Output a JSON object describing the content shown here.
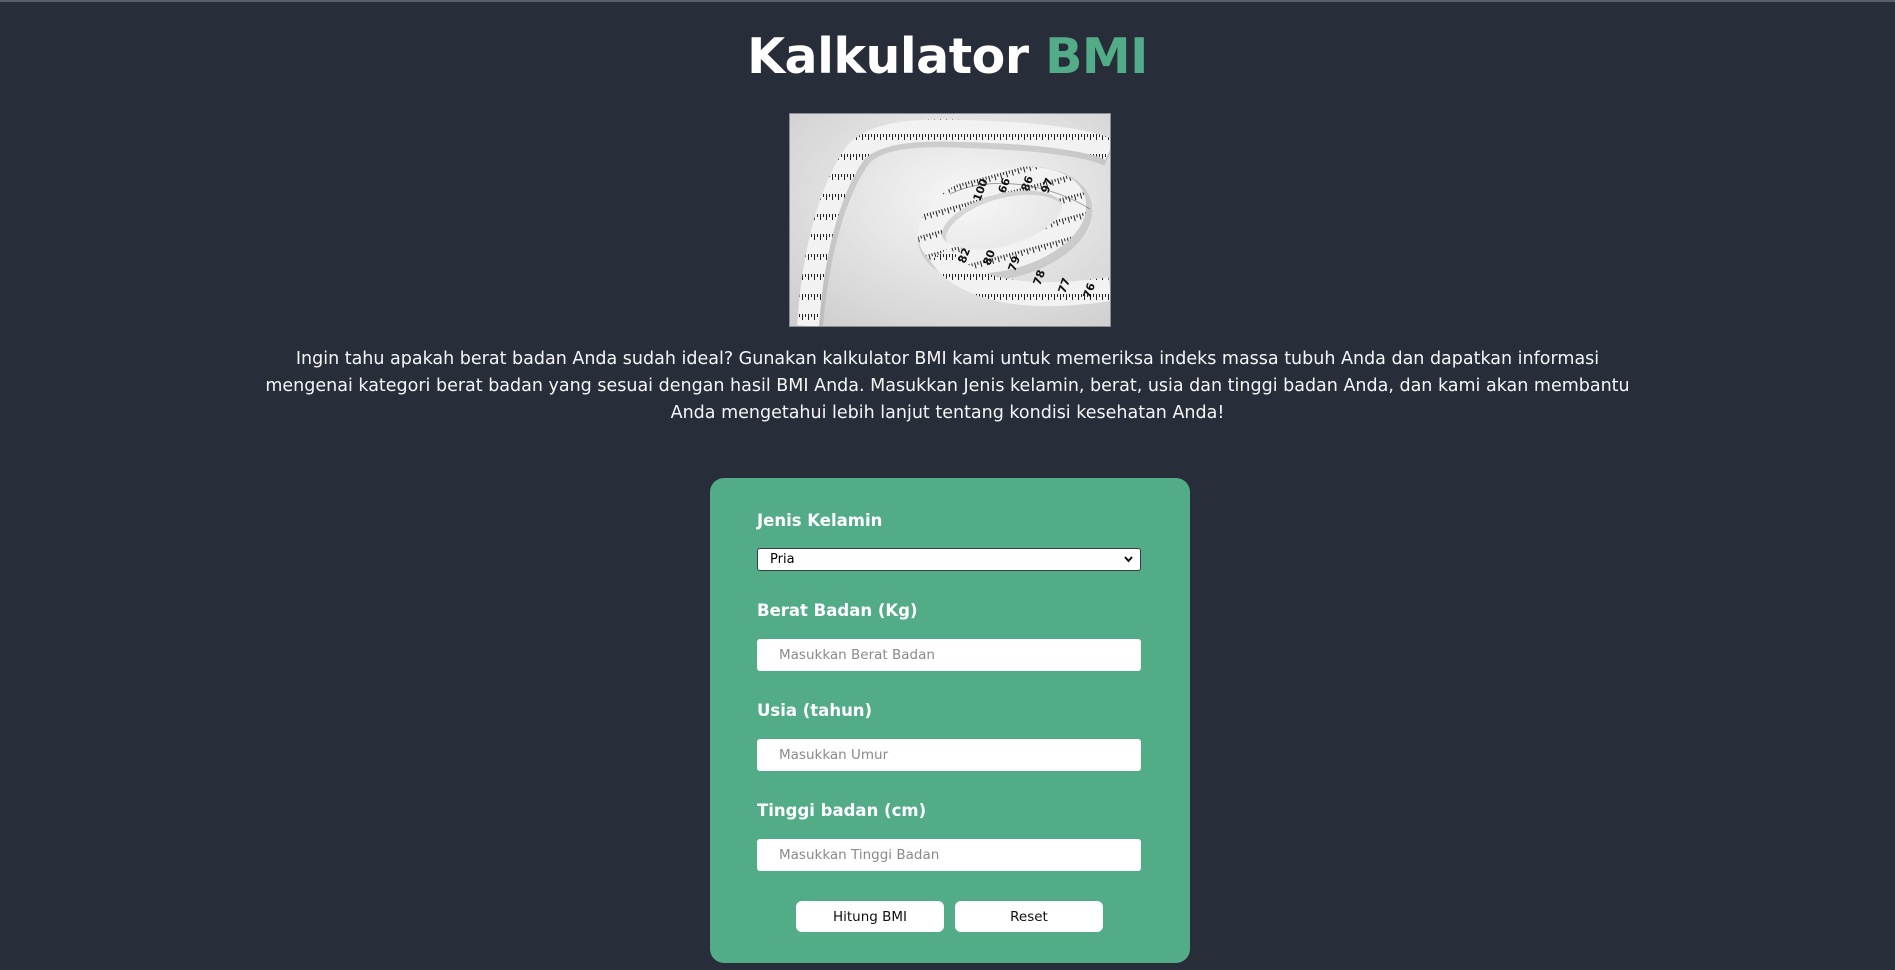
{
  "header": {
    "title_main": "Kalkulator",
    "title_accent": "BMI"
  },
  "hero_image": {
    "alt": "measuring tape"
  },
  "intro_text": "Ingin tahu apakah berat badan Anda sudah ideal? Gunakan kalkulator BMI kami untuk memeriksa indeks massa tubuh Anda dan dapatkan informasi mengenai kategori berat badan yang sesuai dengan hasil BMI Anda. Masukkan Jenis kelamin, berat, usia dan tinggi badan Anda, dan kami akan membantu Anda mengetahui lebih lanjut tentang kondisi kesehatan Anda!",
  "form": {
    "gender": {
      "label": "Jenis Kelamin",
      "selected": "Pria"
    },
    "weight": {
      "label": "Berat Badan (Kg)",
      "placeholder": "Masukkan Berat Badan",
      "value": ""
    },
    "age": {
      "label": "Usia (tahun)",
      "placeholder": "Masukkan Umur",
      "value": ""
    },
    "height": {
      "label": "Tinggi badan (cm)",
      "placeholder": "Masukkan Tinggi Badan",
      "value": ""
    },
    "calculate_label": "Hitung BMI",
    "reset_label": "Reset"
  },
  "colors": {
    "background": "#282e39",
    "accent": "#53ac88",
    "text": "#ffffff"
  }
}
